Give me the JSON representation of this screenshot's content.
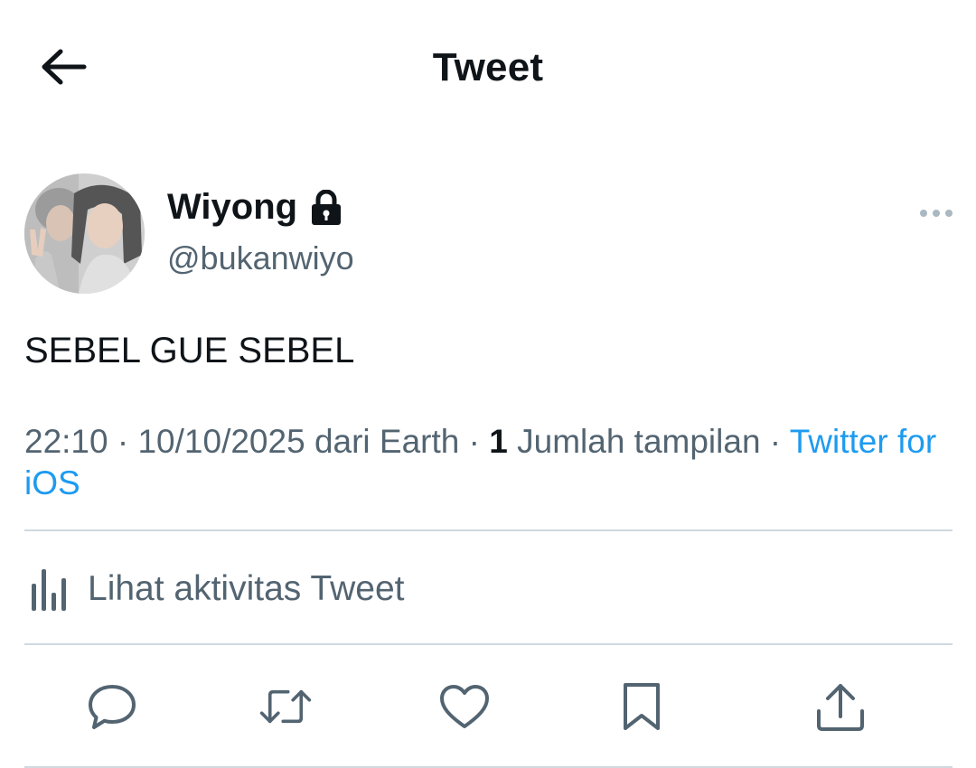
{
  "header": {
    "title": "Tweet",
    "back_icon": "arrow-left-icon"
  },
  "author": {
    "display_name": "Wiyong",
    "handle": "@bukanwiyo",
    "protected_icon": "lock-icon",
    "avatar": "profile-photo"
  },
  "tweet": {
    "text": "SEBEL GUE SEBEL"
  },
  "meta": {
    "time": "22:10",
    "sep1": " · ",
    "date": "10/10/2025",
    "location": " dari Earth",
    "sep2": " · ",
    "views_count": "1",
    "views_label": " Jumlah tampilan",
    "sep3": " · ",
    "source": "Twitter for iOS"
  },
  "activity": {
    "label": "Lihat aktivitas Tweet",
    "icon": "bar-chart-icon"
  },
  "actions": [
    {
      "name": "reply",
      "icon": "reply-icon"
    },
    {
      "name": "retweet",
      "icon": "retweet-icon"
    },
    {
      "name": "like",
      "icon": "heart-icon"
    },
    {
      "name": "bookmark",
      "icon": "bookmark-icon"
    },
    {
      "name": "share",
      "icon": "share-icon"
    }
  ],
  "colors": {
    "text_primary": "#0f1419",
    "text_secondary": "#536471",
    "link": "#1d9bf0",
    "divider": "#cfd9de"
  }
}
